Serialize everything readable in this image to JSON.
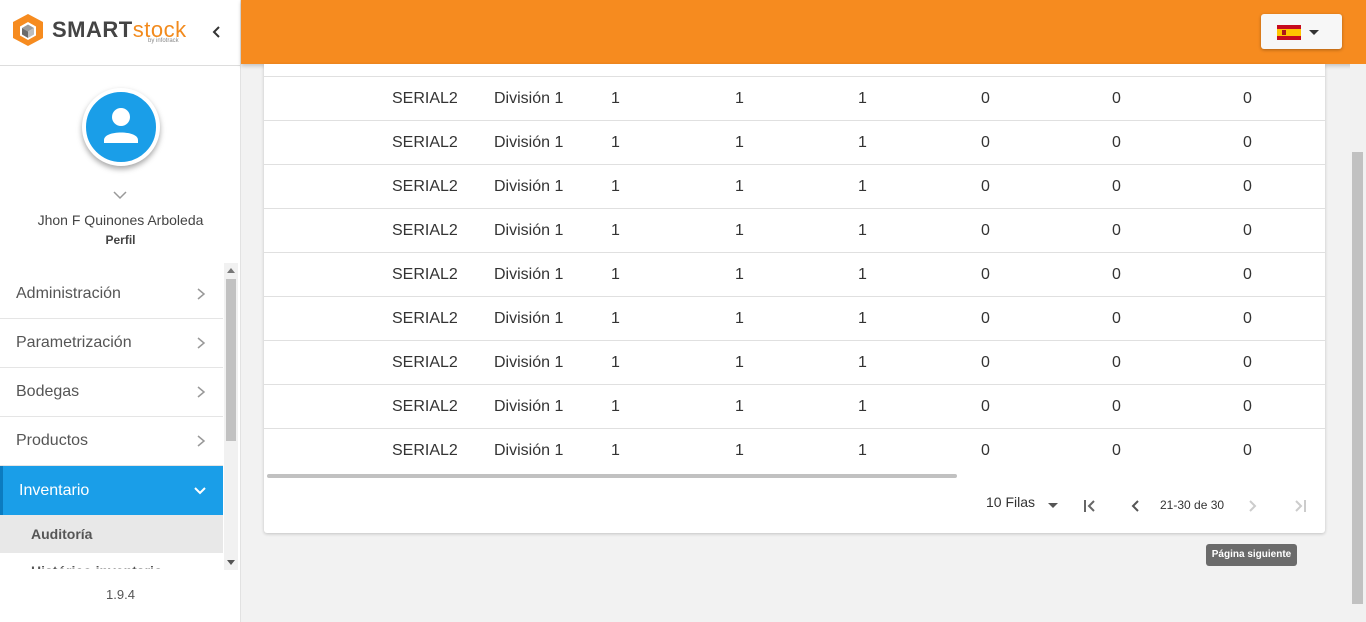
{
  "app": {
    "brand_smart": "SMART",
    "brand_stock": "stock",
    "brand_sub": "by infotrack",
    "accent_color": "#f68b1f",
    "primary_color": "#1a9ee8"
  },
  "sidebar": {
    "collapse_icon": "chevron-left-icon",
    "user_name": "Jhon F Quinones Arboleda",
    "profile_label": "Perfil",
    "menu": [
      {
        "label": "Administración"
      },
      {
        "label": "Parametrización"
      },
      {
        "label": "Bodegas"
      },
      {
        "label": "Productos"
      },
      {
        "label": "Inventario",
        "expanded": true
      }
    ],
    "submenu": [
      {
        "label": "Auditoría",
        "selected": true
      },
      {
        "label": "Histórico inventario"
      }
    ],
    "version": "1.9.4"
  },
  "header": {
    "language": "es",
    "language_icon": "spain-flag-icon"
  },
  "table": {
    "rows": [
      [
        "SERIAL2",
        "División 1",
        "1",
        "1",
        "1",
        "0",
        "0",
        "0"
      ],
      [
        "SERIAL2",
        "División 1",
        "1",
        "1",
        "1",
        "0",
        "0",
        "0"
      ],
      [
        "SERIAL2",
        "División 1",
        "1",
        "1",
        "1",
        "0",
        "0",
        "0"
      ],
      [
        "SERIAL2",
        "División 1",
        "1",
        "1",
        "1",
        "0",
        "0",
        "0"
      ],
      [
        "SERIAL2",
        "División 1",
        "1",
        "1",
        "1",
        "0",
        "0",
        "0"
      ],
      [
        "SERIAL2",
        "División 1",
        "1",
        "1",
        "1",
        "0",
        "0",
        "0"
      ],
      [
        "SERIAL2",
        "División 1",
        "1",
        "1",
        "1",
        "0",
        "0",
        "0"
      ],
      [
        "SERIAL2",
        "División 1",
        "1",
        "1",
        "1",
        "0",
        "0",
        "0"
      ],
      [
        "SERIAL2",
        "División 1",
        "1",
        "1",
        "1",
        "0",
        "0",
        "0"
      ]
    ]
  },
  "pagination": {
    "rows_per_page_label": "10 Filas",
    "range_label": "21-30 de 30",
    "tooltip": "Página siguiente"
  }
}
